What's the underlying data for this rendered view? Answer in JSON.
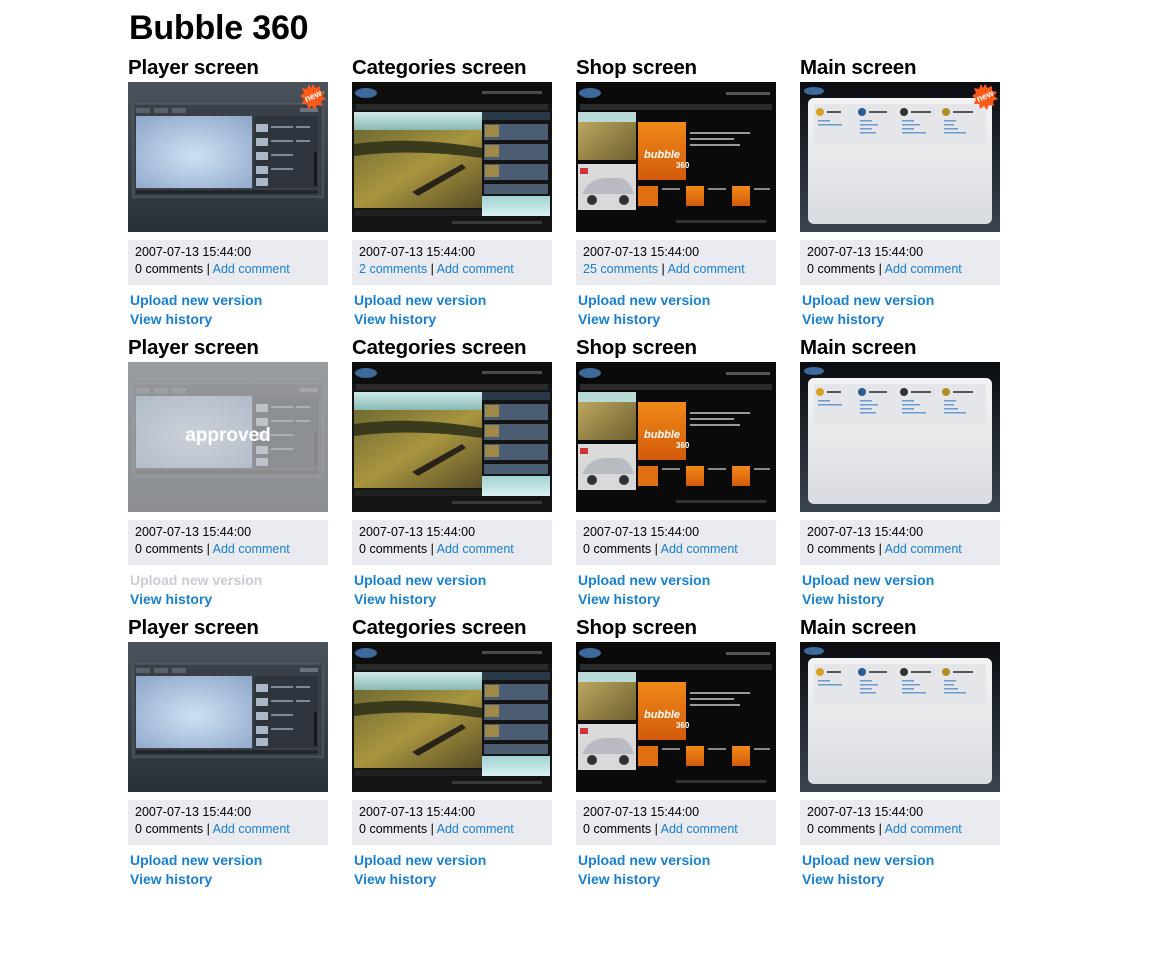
{
  "page": {
    "title": "Bubble 360"
  },
  "labels": {
    "comments_word": "comments",
    "separator": "|"
  },
  "colors": {
    "link": "#1a7fcc",
    "meta_bg": "#e9ebf0",
    "disabled": "#c9ccd2",
    "badge": "#ff5a1a"
  },
  "rows": [
    {
      "cards": [
        {
          "title": "Player screen",
          "thumb": "player-screen",
          "badge": "new",
          "overlay": "",
          "timestamp": "2007-07-13 15:44:00",
          "comments_count": "0",
          "comments_link": false,
          "add_comment": "Add comment",
          "upload": "Upload new version",
          "upload_enabled": true,
          "history": "View history"
        },
        {
          "title": "Categories screen",
          "thumb": "categories-screen",
          "badge": "",
          "overlay": "",
          "timestamp": "2007-07-13 15:44:00",
          "comments_count": "2",
          "comments_link": true,
          "add_comment": "Add comment",
          "upload": "Upload new version",
          "upload_enabled": true,
          "history": "View history"
        },
        {
          "title": "Shop screen",
          "thumb": "shop-screen",
          "badge": "",
          "overlay": "",
          "timestamp": "2007-07-13 15:44:00",
          "comments_count": "25",
          "comments_link": true,
          "add_comment": "Add comment",
          "upload": "Upload new version",
          "upload_enabled": true,
          "history": "View history"
        },
        {
          "title": "Main screen",
          "thumb": "main-screen",
          "badge": "new",
          "overlay": "",
          "timestamp": "2007-07-13 15:44:00",
          "comments_count": "0",
          "comments_link": false,
          "add_comment": "Add comment",
          "upload": "Upload new version",
          "upload_enabled": true,
          "history": "View history"
        }
      ]
    },
    {
      "cards": [
        {
          "title": "Player screen",
          "thumb": "player-screen",
          "badge": "",
          "overlay": "approved",
          "timestamp": "2007-07-13 15:44:00",
          "comments_count": "0",
          "comments_link": false,
          "add_comment": "Add comment",
          "upload": "Upload new version",
          "upload_enabled": false,
          "history": "View history"
        },
        {
          "title": "Categories screen",
          "thumb": "categories-screen",
          "badge": "",
          "overlay": "",
          "timestamp": "2007-07-13 15:44:00",
          "comments_count": "0",
          "comments_link": false,
          "add_comment": "Add comment",
          "upload": "Upload new version",
          "upload_enabled": true,
          "history": "View history"
        },
        {
          "title": "Shop screen",
          "thumb": "shop-screen",
          "badge": "",
          "overlay": "",
          "timestamp": "2007-07-13 15:44:00",
          "comments_count": "0",
          "comments_link": false,
          "add_comment": "Add comment",
          "upload": "Upload new version",
          "upload_enabled": true,
          "history": "View history"
        },
        {
          "title": "Main screen",
          "thumb": "main-screen",
          "badge": "",
          "overlay": "",
          "timestamp": "2007-07-13 15:44:00",
          "comments_count": "0",
          "comments_link": false,
          "add_comment": "Add comment",
          "upload": "Upload new version",
          "upload_enabled": true,
          "history": "View history"
        }
      ]
    },
    {
      "cards": [
        {
          "title": "Player screen",
          "thumb": "player-screen",
          "badge": "",
          "overlay": "",
          "timestamp": "2007-07-13 15:44:00",
          "comments_count": "0",
          "comments_link": false,
          "add_comment": "Add comment",
          "upload": "Upload new version",
          "upload_enabled": true,
          "history": "View history"
        },
        {
          "title": "Categories screen",
          "thumb": "categories-screen",
          "badge": "",
          "overlay": "",
          "timestamp": "2007-07-13 15:44:00",
          "comments_count": "0",
          "comments_link": false,
          "add_comment": "Add comment",
          "upload": "Upload new version",
          "upload_enabled": true,
          "history": "View history"
        },
        {
          "title": "Shop screen",
          "thumb": "shop-screen",
          "badge": "",
          "overlay": "",
          "timestamp": "2007-07-13 15:44:00",
          "comments_count": "0",
          "comments_link": false,
          "add_comment": "Add comment",
          "upload": "Upload new version",
          "upload_enabled": true,
          "history": "View history"
        },
        {
          "title": "Main screen",
          "thumb": "main-screen",
          "badge": "",
          "overlay": "",
          "timestamp": "2007-07-13 15:44:00",
          "comments_count": "0",
          "comments_link": false,
          "add_comment": "Add comment",
          "upload": "Upload new version",
          "upload_enabled": true,
          "history": "View history"
        }
      ]
    }
  ]
}
